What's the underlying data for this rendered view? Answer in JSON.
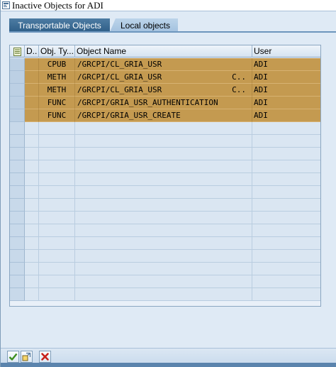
{
  "window": {
    "title": "Inactive Objects for ADI"
  },
  "tabs": [
    {
      "label": "Transportable Objects",
      "active": true
    },
    {
      "label": "Local objects",
      "active": false
    }
  ],
  "table": {
    "columns": [
      "D..",
      "Obj. Ty...",
      "Object Name",
      "User"
    ],
    "rows": [
      {
        "type": "CPUB",
        "name": "/GRCPI/CL_GRIA_USR",
        "cont": "",
        "user": "ADI"
      },
      {
        "type": "METH",
        "name": "/GRCPI/CL_GRIA_USR",
        "cont": "C..",
        "user": "ADI"
      },
      {
        "type": "METH",
        "name": "/GRCPI/CL_GRIA_USR",
        "cont": "C..",
        "user": "ADI"
      },
      {
        "type": "FUNC",
        "name": "/GRCPI/GRIA_USR_AUTHENTICATION",
        "cont": "",
        "user": "ADI"
      },
      {
        "type": "FUNC",
        "name": "/GRCPI/GRIA_USR_CREATE",
        "cont": "",
        "user": "ADI"
      }
    ],
    "empty_row_count": 14
  },
  "toolbar": {
    "icons": [
      "checkmark-icon",
      "activate-icon",
      "cancel-icon"
    ]
  },
  "colors": {
    "selected_row": "#c49a50",
    "active_tab": "#2f5f88",
    "inactive_tab": "#a3c2df",
    "background": "#dfeaf5"
  }
}
